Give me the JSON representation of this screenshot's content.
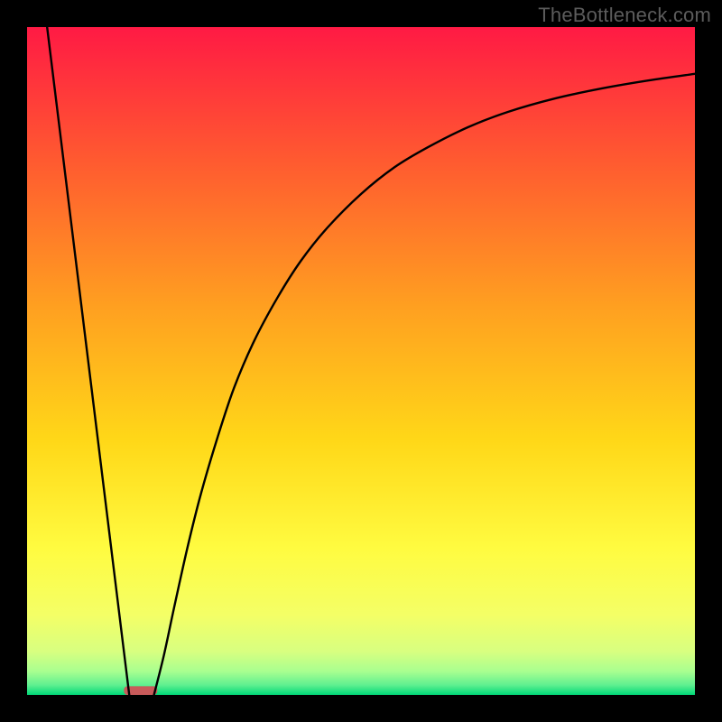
{
  "watermark": "TheBottleneck.com",
  "chart_data": {
    "type": "line",
    "title": "",
    "xlabel": "",
    "ylabel": "",
    "xlim": [
      0,
      100
    ],
    "ylim": [
      0,
      100
    ],
    "gradient_stops": [
      {
        "offset": 0.0,
        "color": "#ff1a44"
      },
      {
        "offset": 0.2,
        "color": "#ff5a30"
      },
      {
        "offset": 0.42,
        "color": "#ffa020"
      },
      {
        "offset": 0.62,
        "color": "#ffd818"
      },
      {
        "offset": 0.78,
        "color": "#fffb40"
      },
      {
        "offset": 0.88,
        "color": "#f4ff66"
      },
      {
        "offset": 0.935,
        "color": "#d8ff80"
      },
      {
        "offset": 0.965,
        "color": "#a8ff90"
      },
      {
        "offset": 0.985,
        "color": "#60f090"
      },
      {
        "offset": 1.0,
        "color": "#00d878"
      }
    ],
    "marker": {
      "x": 17.0,
      "y": 0.0,
      "width_pct": 5.0,
      "height_pct": 1.3,
      "color": "#c85a5a",
      "rx": 4
    },
    "series": [
      {
        "name": "left-line",
        "type": "line",
        "x": [
          3.0,
          15.3
        ],
        "y": [
          100.0,
          0.0
        ]
      },
      {
        "name": "right-curve",
        "type": "line",
        "x": [
          19.0,
          20.5,
          22.0,
          24.0,
          26.0,
          28.5,
          31.0,
          34.0,
          37.5,
          41.0,
          45.0,
          50.0,
          55.0,
          60.0,
          66.0,
          72.0,
          79.0,
          86.0,
          93.0,
          100.0
        ],
        "y": [
          0.0,
          6.0,
          13.0,
          22.0,
          30.0,
          38.5,
          46.0,
          53.0,
          59.5,
          65.0,
          70.0,
          75.0,
          79.0,
          82.0,
          85.0,
          87.3,
          89.3,
          90.8,
          92.0,
          93.0
        ]
      }
    ]
  }
}
